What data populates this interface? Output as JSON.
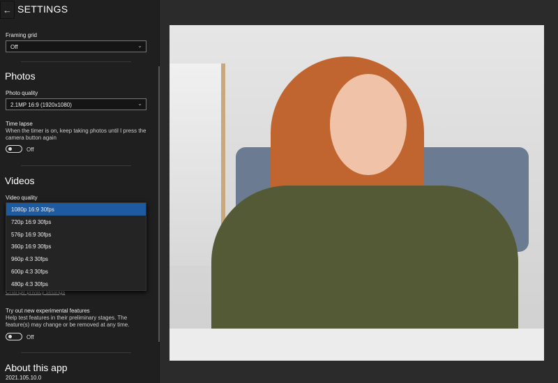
{
  "header": {
    "back_icon": "arrow-left-icon",
    "title": "SETTINGS"
  },
  "framing": {
    "label": "Framing grid",
    "value": "Off"
  },
  "photos": {
    "heading": "Photos",
    "quality_label": "Photo quality",
    "quality_value": "2.1MP 16:9 (1920x1080)",
    "timelapse_label": "Time lapse",
    "timelapse_desc": "When the timer is on, keep taking photos until I press the camera button again",
    "timelapse_state": "Off"
  },
  "videos": {
    "heading": "Videos",
    "quality_label": "Video quality",
    "options": [
      "1080p 16:9 30fps",
      "720p 16:9 30fps",
      "576p 16:9 30fps",
      "360p 16:9 30fps",
      "960p 4:3 30fps",
      "600p 4:3 30fps",
      "480p 4:3 30fps"
    ],
    "selected": "1080p 16:9 30fps"
  },
  "privacy_link": "Change privacy settings",
  "experimental": {
    "label": "Try out new experimental features",
    "desc": "Help test features in their preliminary stages. The feature(s) may change or be removed at any time.",
    "state": "Off"
  },
  "about": {
    "heading": "About this app",
    "version": "2021.105.10.0"
  },
  "colors": {
    "accent": "#1d5aa0",
    "panel": "#1f1f1f"
  }
}
